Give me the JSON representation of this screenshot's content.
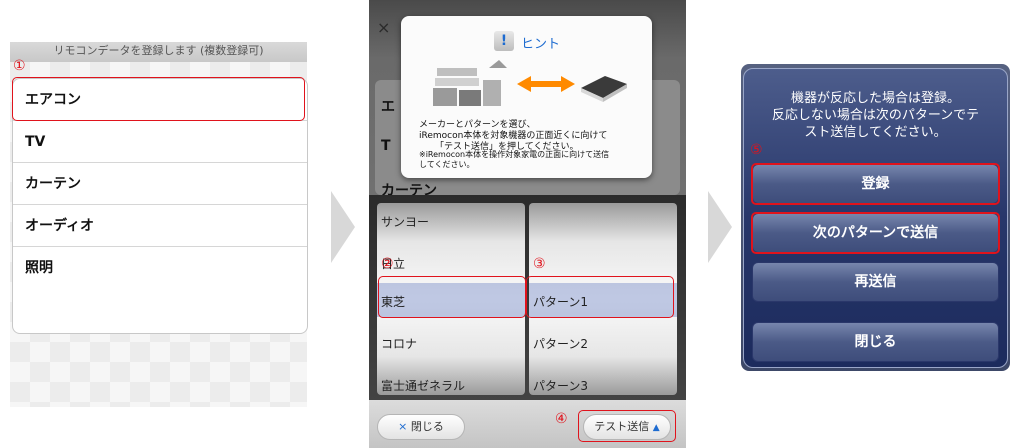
{
  "panel1": {
    "header": "リモコンデータを登録します (複数登録可)",
    "step_marker": "①",
    "items": [
      "エアコン",
      "TV",
      "カーテン",
      "オーディオ",
      "照明"
    ]
  },
  "panel2": {
    "bg_rows": [
      "エ",
      "T",
      "カーテン"
    ],
    "hint": {
      "title": "ヒント",
      "badge": "!",
      "line1": "メーカーとパターンを選び、",
      "line2": "iRemocon本体を対象機器の正面近くに向けて",
      "line3": "「テスト送信」を押してください。",
      "note1": "※iRemocon本体を操作対象家電の正面に向けて送信",
      "note2": "してください。"
    },
    "makers": [
      "サンヨー",
      "日立",
      "東芝",
      "コロナ",
      "富士通ゼネラル"
    ],
    "patterns": [
      "パターン1",
      "パターン2",
      "パターン3"
    ],
    "markers": {
      "maker": "②",
      "pattern": "③",
      "test": "④"
    },
    "close_label": "閉じる",
    "close_glyph": "×",
    "test_label": "テスト送信"
  },
  "panel3": {
    "message_line1": "機器が反応した場合は登録。",
    "message_line2": "反応しない場合は次のパターンでテ",
    "message_line3": "スト送信してください。",
    "marker": "⑤",
    "buttons": [
      "登録",
      "次のパターンで送信",
      "再送信",
      "閉じる"
    ]
  },
  "colors": {
    "highlight": "#e0131c",
    "accent_arrow": "#ff8a00",
    "dialog_blue": "#27366a"
  }
}
